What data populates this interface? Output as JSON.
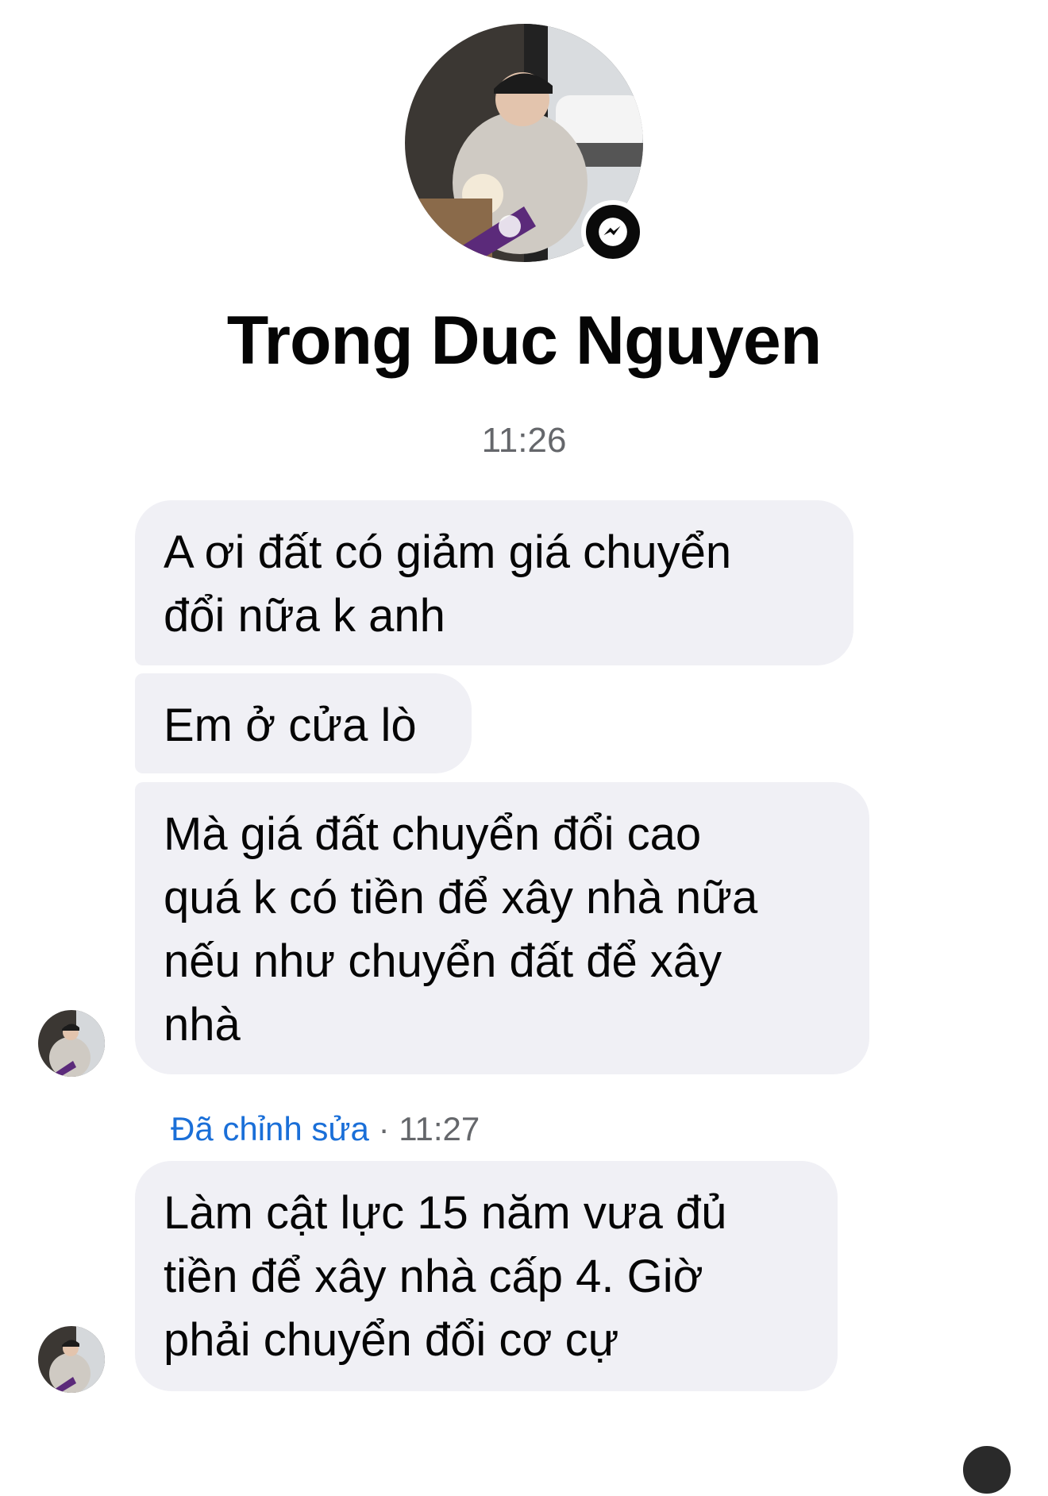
{
  "header": {
    "contact_name": "Trong Duc Nguyen",
    "avatar_icon": "profile-photo",
    "badge_icon": "messenger-icon"
  },
  "conversation": {
    "time_separator": "11:26",
    "messages": [
      {
        "text": "A ơi đất có giảm giá chuyển\nđổi nữa k anh"
      },
      {
        "text": "Em ở cửa lò"
      },
      {
        "text": "Mà giá đất chuyển đổi cao\nquá k có tiền để xây nhà nữa\nnếu như chuyển đất để xây\nnhà"
      },
      {
        "text": "Làm cật lực 15 năm vưa đủ\ntiền để xây nhà cấp 4. Giờ\nphải chuyển đổi cơ cự"
      }
    ],
    "edit_meta": {
      "edited_label": "Đã chỉnh sửa",
      "separator": " · ",
      "time": "11:27"
    }
  },
  "colors": {
    "bubble_background": "#f0f0f5",
    "edited_link": "#1a6fd8",
    "muted_text": "#65676b"
  }
}
